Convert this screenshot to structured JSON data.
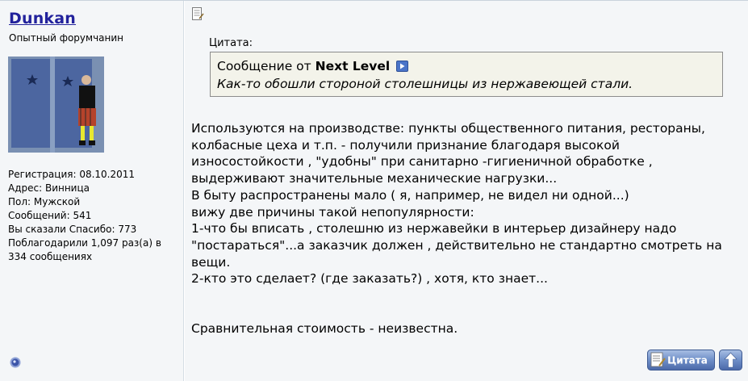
{
  "user": {
    "name": "Dunkan",
    "title": "Опытный форумчанин",
    "info": [
      "Регистрация: 08.10.2011",
      "Адрес: Винница",
      "Пол: Мужской",
      "Сообщений: 541",
      "Вы сказали Спасибо: 773",
      "Поблагодарили 1,097 раз(а) в 334 сообщениях"
    ]
  },
  "quote": {
    "caption": "Цитата:",
    "prefix": "Сообщение от",
    "author": "Next Level",
    "text": "Как-то обошли стороной столешницы из нержавеющей стали."
  },
  "message": {
    "lines": [
      "Используются на производстве: пункты общественного питания, рестораны,",
      "колбасные цеха и т.п. - получили признание благодаря высокой",
      "износостойкости , \"удобны\" при санитарно -гигиеничной обработке ,",
      "выдерживают значительные механические нагрузки...",
      "В быту распространены мало ( я, например, не видел ни одной...)",
      "вижу две причины такой непопулярности:",
      "1-что бы вписать , столешню из нержавейки в интерьер дизайнеру надо",
      "\"постараться\"...а заказчик должен , действительно не стандартно смотреть на",
      "вещи.",
      "2-кто это сделает? (где заказать?) , хотя, кто знает..."
    ],
    "closing": "Сравнительная стоимость - неизвестна."
  },
  "buttons": {
    "quote_label": "Цитата"
  },
  "icons": {
    "online": "online-status-icon",
    "post": "post-document-icon",
    "goto": "goto-post-icon",
    "top": "scroll-top-icon"
  },
  "colors": {
    "username": "#22229c",
    "panel_bg": "#f4f6f8",
    "quote_bg": "#f3f3ea"
  }
}
